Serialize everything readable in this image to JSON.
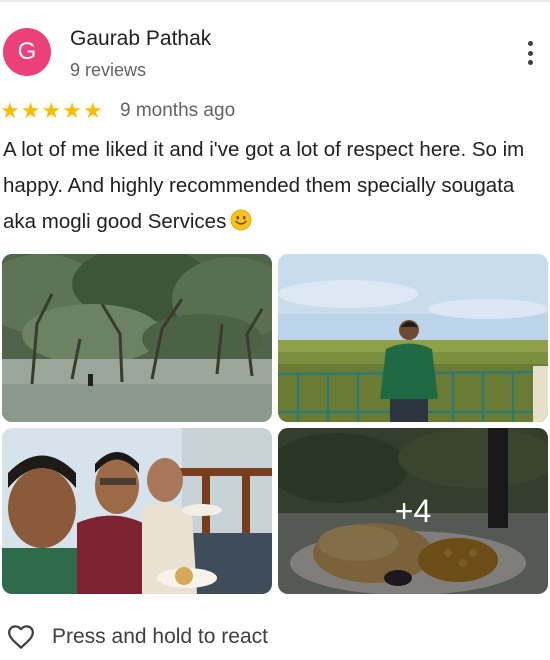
{
  "review": {
    "author": {
      "initial": "G",
      "name": "Gaurab Pathak",
      "review_count": "9 reviews",
      "avatar_color": "#ec407a"
    },
    "rating": 5,
    "date": "9 months ago",
    "text": "A lot of me liked it and i've got a lot of respect here. So im happy. And highly recommended them specially sougata aka mogli good Services",
    "text_emoji": "smiling-face-emoji",
    "photos": [
      {
        "icon": "mangrove-forest-photo"
      },
      {
        "icon": "man-on-watchtower-photo"
      },
      {
        "icon": "group-selfie-photo"
      },
      {
        "icon": "food-plate-photo",
        "more_label": "+4"
      }
    ],
    "react_label": "Press and hold to react",
    "react_icon": "heart-icon",
    "menu_icon": "more-vert-icon",
    "star_color": "#fbbc04"
  }
}
